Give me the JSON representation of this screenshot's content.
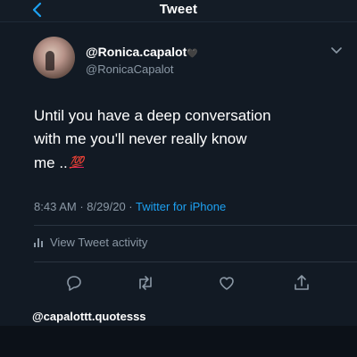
{
  "header": {
    "title": "Tweet",
    "back_icon": "chevron-left-icon"
  },
  "author": {
    "display_name": "@Ronica.capalot",
    "name_emoji": "🖤",
    "handle": "@RonicaCapalot"
  },
  "tweet": {
    "lines": [
      "Until you have a deep conversation",
      "with me you'll never really know",
      "me .."
    ],
    "emoji": "💯"
  },
  "meta": {
    "time": "8:43 AM",
    "date": "8/29/20",
    "separator": "·",
    "source": "Twitter for iPhone"
  },
  "activity": {
    "label": "View Tweet activity"
  },
  "actions": [
    "reply-icon",
    "retweet-icon",
    "like-icon",
    "share-icon"
  ],
  "credit": "@capalottt.quotesss",
  "colors": {
    "background": "#121a24",
    "link": "#1da1f2",
    "muted": "#8b98a5"
  }
}
